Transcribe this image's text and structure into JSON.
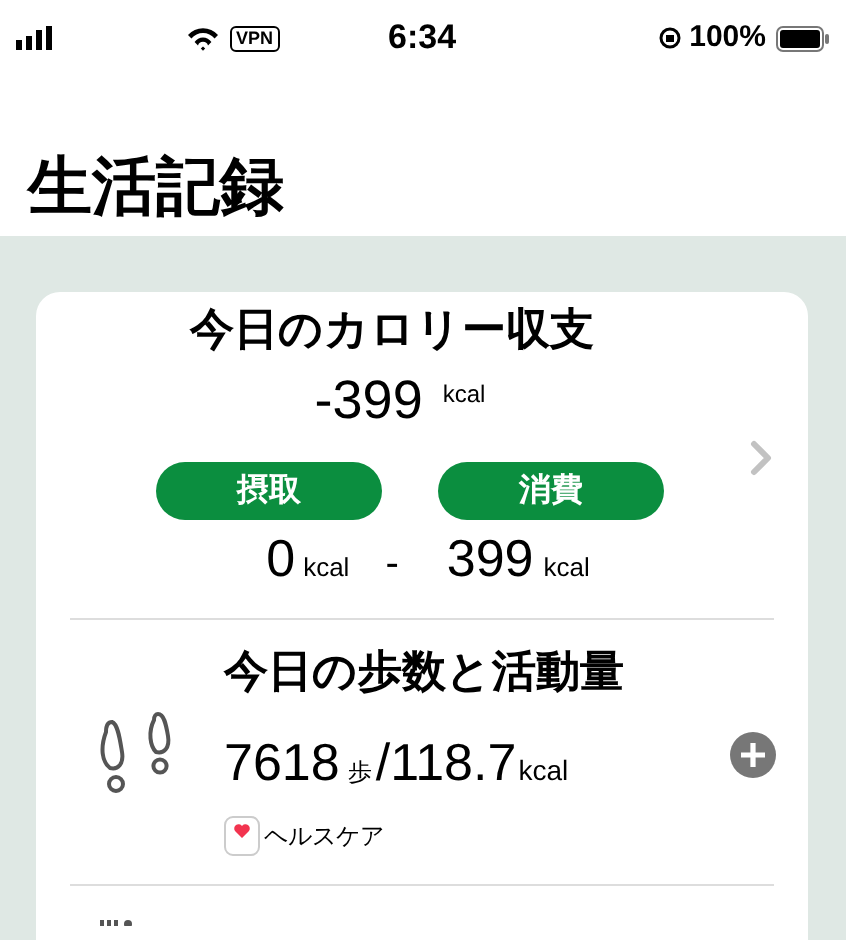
{
  "status_bar": {
    "time": "6:34",
    "vpn": "VPN",
    "battery": "100%"
  },
  "page_title": "生活記録",
  "calorie_card": {
    "title": "今日のカロリー収支",
    "balance": "-399",
    "balance_unit": "kcal",
    "intake": {
      "label": "摂取",
      "value": "0",
      "unit": "kcal"
    },
    "separator": "-",
    "burned": {
      "label": "消費",
      "value": "399",
      "unit": "kcal"
    }
  },
  "activity_card": {
    "title": "今日の歩数と活動量",
    "steps": "7618",
    "steps_unit": "歩",
    "calories": "/118.7",
    "calories_unit": "kcal",
    "source": "ヘルスケア"
  }
}
